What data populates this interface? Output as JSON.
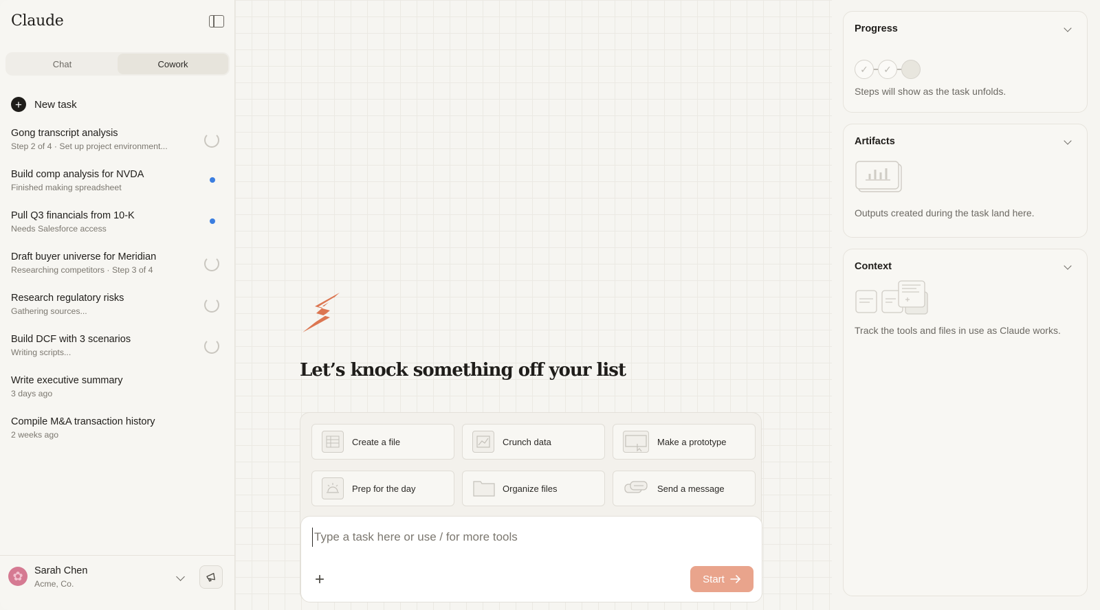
{
  "app": {
    "name": "Claude"
  },
  "sidebar": {
    "tabs": [
      {
        "label": "Chat",
        "active": false
      },
      {
        "label": "Cowork",
        "active": true
      }
    ],
    "new_task_label": "New task",
    "tasks": [
      {
        "title": "Gong transcript analysis",
        "subtitle": "Step 2 of 4 · Set up project environment...",
        "status": "in-progress"
      },
      {
        "title": "Build comp analysis for NVDA",
        "subtitle": "Finished making spreadsheet",
        "status": "unread"
      },
      {
        "title": "Pull Q3 financials from 10-K",
        "subtitle": "Needs Salesforce access",
        "status": "unread"
      },
      {
        "title": "Draft buyer universe for Meridian",
        "subtitle": "Researching competitors · Step 3 of 4",
        "status": "in-progress"
      },
      {
        "title": "Research regulatory risks",
        "subtitle": "Gathering sources...",
        "status": "in-progress"
      },
      {
        "title": "Build DCF with 3 scenarios",
        "subtitle": "Writing scripts...",
        "status": "in-progress"
      },
      {
        "title": "Write executive summary",
        "subtitle": "3 days ago",
        "status": "done"
      },
      {
        "title": "Compile M&A transaction history",
        "subtitle": "2 weeks ago",
        "status": "done"
      }
    ],
    "user": {
      "name": "Sarah Chen",
      "org": "Acme, Co."
    }
  },
  "main": {
    "headline": "Let’s knock something off your list",
    "quick_actions": [
      {
        "label": "Create a file",
        "icon": "spreadsheet-icon"
      },
      {
        "label": "Crunch data",
        "icon": "chart-icon"
      },
      {
        "label": "Make a prototype",
        "icon": "prototype-icon"
      },
      {
        "label": "Prep for the day",
        "icon": "sunrise-icon"
      },
      {
        "label": "Organize files",
        "icon": "folder-icon"
      },
      {
        "label": "Send a message",
        "icon": "message-icon"
      }
    ],
    "input": {
      "placeholder": "Type a task here or use / for more tools",
      "value": ""
    },
    "start_label": "Start"
  },
  "right_panel": {
    "progress": {
      "title": "Progress",
      "text": "Steps will show as the task unfolds."
    },
    "artifacts": {
      "title": "Artifacts",
      "text": "Outputs created during the task land here."
    },
    "context": {
      "title": "Context",
      "text": "Track the tools and files in use as Claude works."
    }
  },
  "colors": {
    "accent": "#e9a48c",
    "logo": "#d9683f",
    "unread_dot": "#3b7ee0",
    "background": "#f6f5f1"
  }
}
